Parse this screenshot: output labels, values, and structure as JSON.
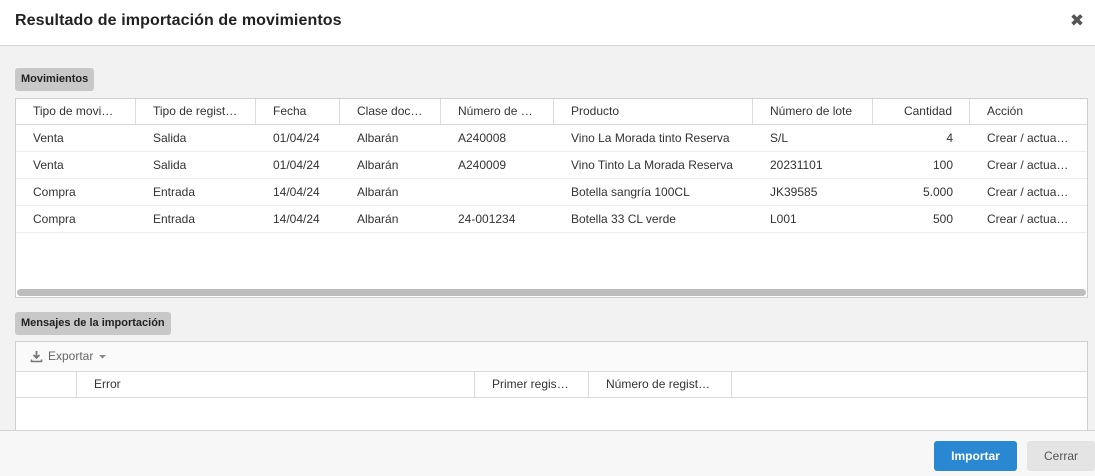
{
  "dialog": {
    "title": "Resultado de importación de movimientos",
    "close_icon": "close-icon"
  },
  "movements": {
    "section_label": "Movimientos",
    "columns": [
      "Tipo de movi…",
      "Tipo de regist…",
      "Fecha",
      "Clase docu…",
      "Número de d…",
      "Producto",
      "Número de lote",
      "Cantidad",
      "Acción"
    ],
    "rows": [
      [
        "Venta",
        "Salida",
        "01/04/24",
        "Albarán",
        "A240008",
        "Vino La Morada tinto Reserva",
        "S/L",
        "4",
        "Crear / actuali…"
      ],
      [
        "Venta",
        "Salida",
        "01/04/24",
        "Albarán",
        "A240009",
        "Vino Tinto La Morada Reserva",
        "20231101",
        "100",
        "Crear / actuali…"
      ],
      [
        "Compra",
        "Entrada",
        "14/04/24",
        "Albarán",
        "",
        "Botella sangría 100CL",
        "JK39585",
        "5.000",
        "Crear / actuali…"
      ],
      [
        "Compra",
        "Entrada",
        "14/04/24",
        "Albarán",
        "24-001234",
        "Botella 33 CL verde",
        "L001",
        "500",
        "Crear / actuali…"
      ]
    ]
  },
  "messages": {
    "section_label": "Mensajes de la importación",
    "export_label": "Exportar",
    "columns": [
      "",
      "Error",
      "Primer regist…",
      "Número de registr…",
      ""
    ]
  },
  "footer": {
    "import_label": "Importar",
    "close_label": "Cerrar"
  },
  "colors": {
    "primary": "#2a88d2",
    "secondary": "#e4e4e4"
  }
}
